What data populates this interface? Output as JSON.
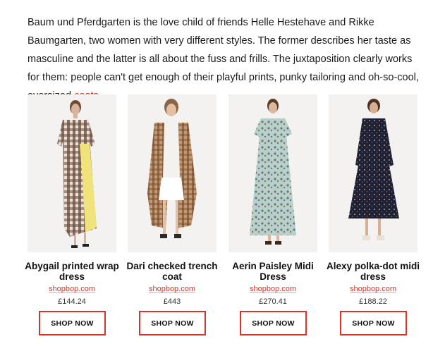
{
  "article": {
    "intro_text": "Baum und Pferdgarten is the love child of friends Helle Hestehave and Rikke Baumgarten, two women with very different styles. The former describes her taste as masculine and the latter is all about the fuss and frills. The juxtaposition clearly works for them: people can't get enough of their playful prints, punky tailoring and oh-so-cool, oversized ",
    "link_text": "coats",
    "intro_end": "."
  },
  "products": [
    {
      "name": "Abygail printed wrap dress",
      "store": "shopbop.com",
      "price": "£144.24",
      "button": "SHOP NOW"
    },
    {
      "name": "Dari checked trench coat",
      "store": "shopbop.com",
      "price": "£443",
      "button": "SHOP NOW"
    },
    {
      "name": "Aerin Paisley Midi Dress",
      "store": "shopbop.com",
      "price": "£270.41",
      "button": "SHOP NOW"
    },
    {
      "name": "Alexy polka-dot midi dress",
      "store": "shopbop.com",
      "price": "£188.22",
      "button": "SHOP NOW"
    }
  ],
  "colors": {
    "accent": "#d8322a",
    "text": "#1a1a1a",
    "photo_bg": "#f3f2f0"
  }
}
